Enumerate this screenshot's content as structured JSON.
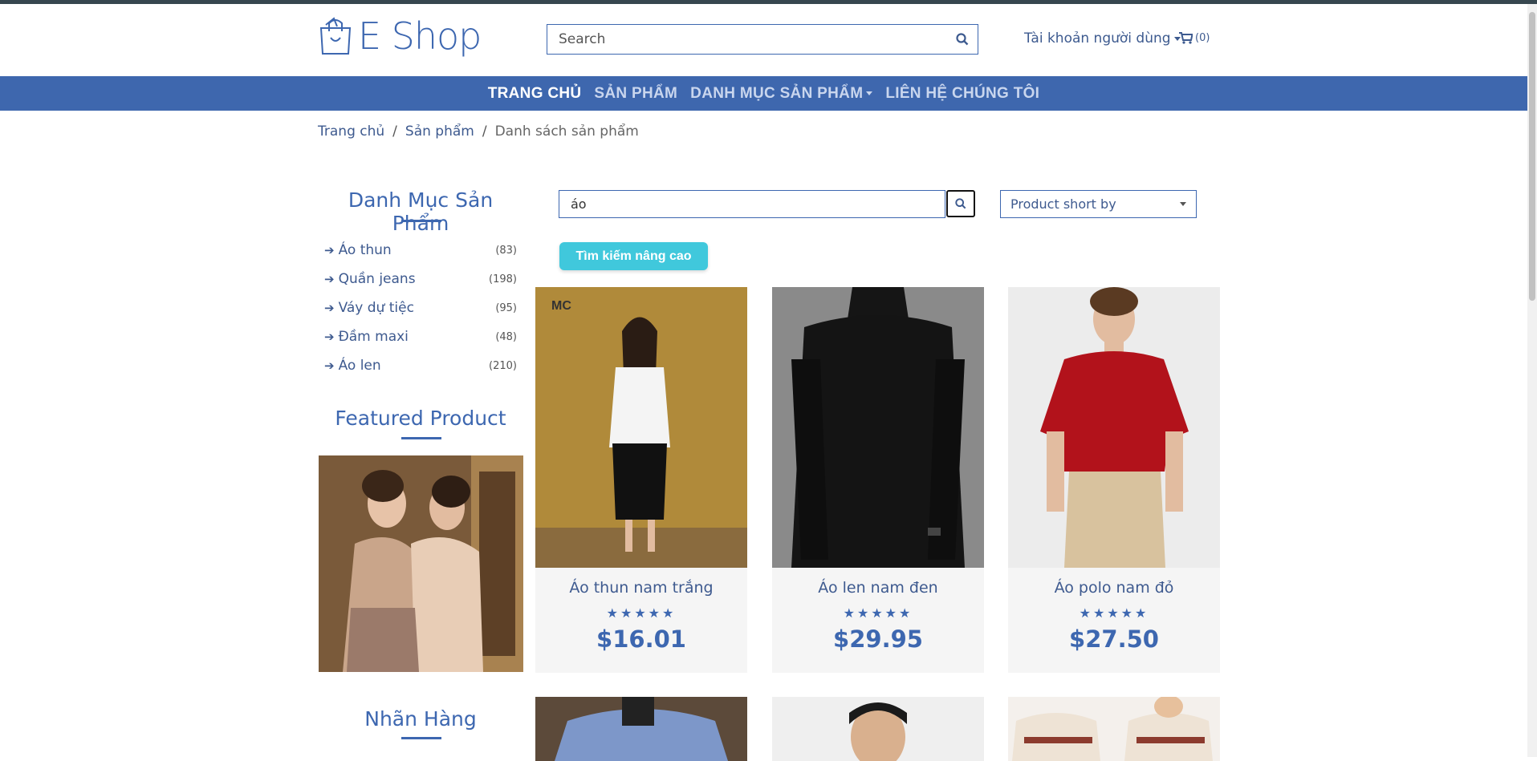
{
  "header": {
    "logo_text": "E Shop",
    "search_placeholder": "Search",
    "account_label": "Tài khoản người dùng",
    "cart_count": "(0)"
  },
  "nav": {
    "items": [
      {
        "label": "TRANG CHỦ"
      },
      {
        "label": "SẢN PHẨM"
      },
      {
        "label": "DANH MỤC SẢN PHẨM"
      },
      {
        "label": "LIÊN HỆ CHÚNG TÔI"
      }
    ]
  },
  "breadcrumb": {
    "items": [
      "Trang chủ",
      "Sản phẩm",
      "Danh sách sản phẩm"
    ],
    "separator": "/"
  },
  "sidebar": {
    "categories_title": "Danh Mục Sản Phẩm",
    "categories": [
      {
        "name": "Áo thun",
        "count": "(83)"
      },
      {
        "name": "Quần jeans",
        "count": "(198)"
      },
      {
        "name": "Váy dự tiệc",
        "count": "(95)"
      },
      {
        "name": "Đầm maxi",
        "count": "(48)"
      },
      {
        "name": "Áo len",
        "count": "(210)"
      }
    ],
    "featured_title": "Featured Product",
    "brands_title": "Nhãn Hàng"
  },
  "main": {
    "search_value": "áo",
    "sort_label": "Product short by",
    "advanced_search_label": "Tìm kiếm nâng cao",
    "products": [
      {
        "name": "Áo thun nam trắng",
        "price": "$16.01",
        "rating": 5
      },
      {
        "name": "Áo len nam đen",
        "price": "$29.95",
        "rating": 5
      },
      {
        "name": "Áo polo nam đỏ",
        "price": "$27.50",
        "rating": 5
      }
    ],
    "stars_text": "★★★★★"
  },
  "colors": {
    "brand": "#3d67b0",
    "navbar": "#3e67ae",
    "accent_button": "#40c8dc"
  }
}
